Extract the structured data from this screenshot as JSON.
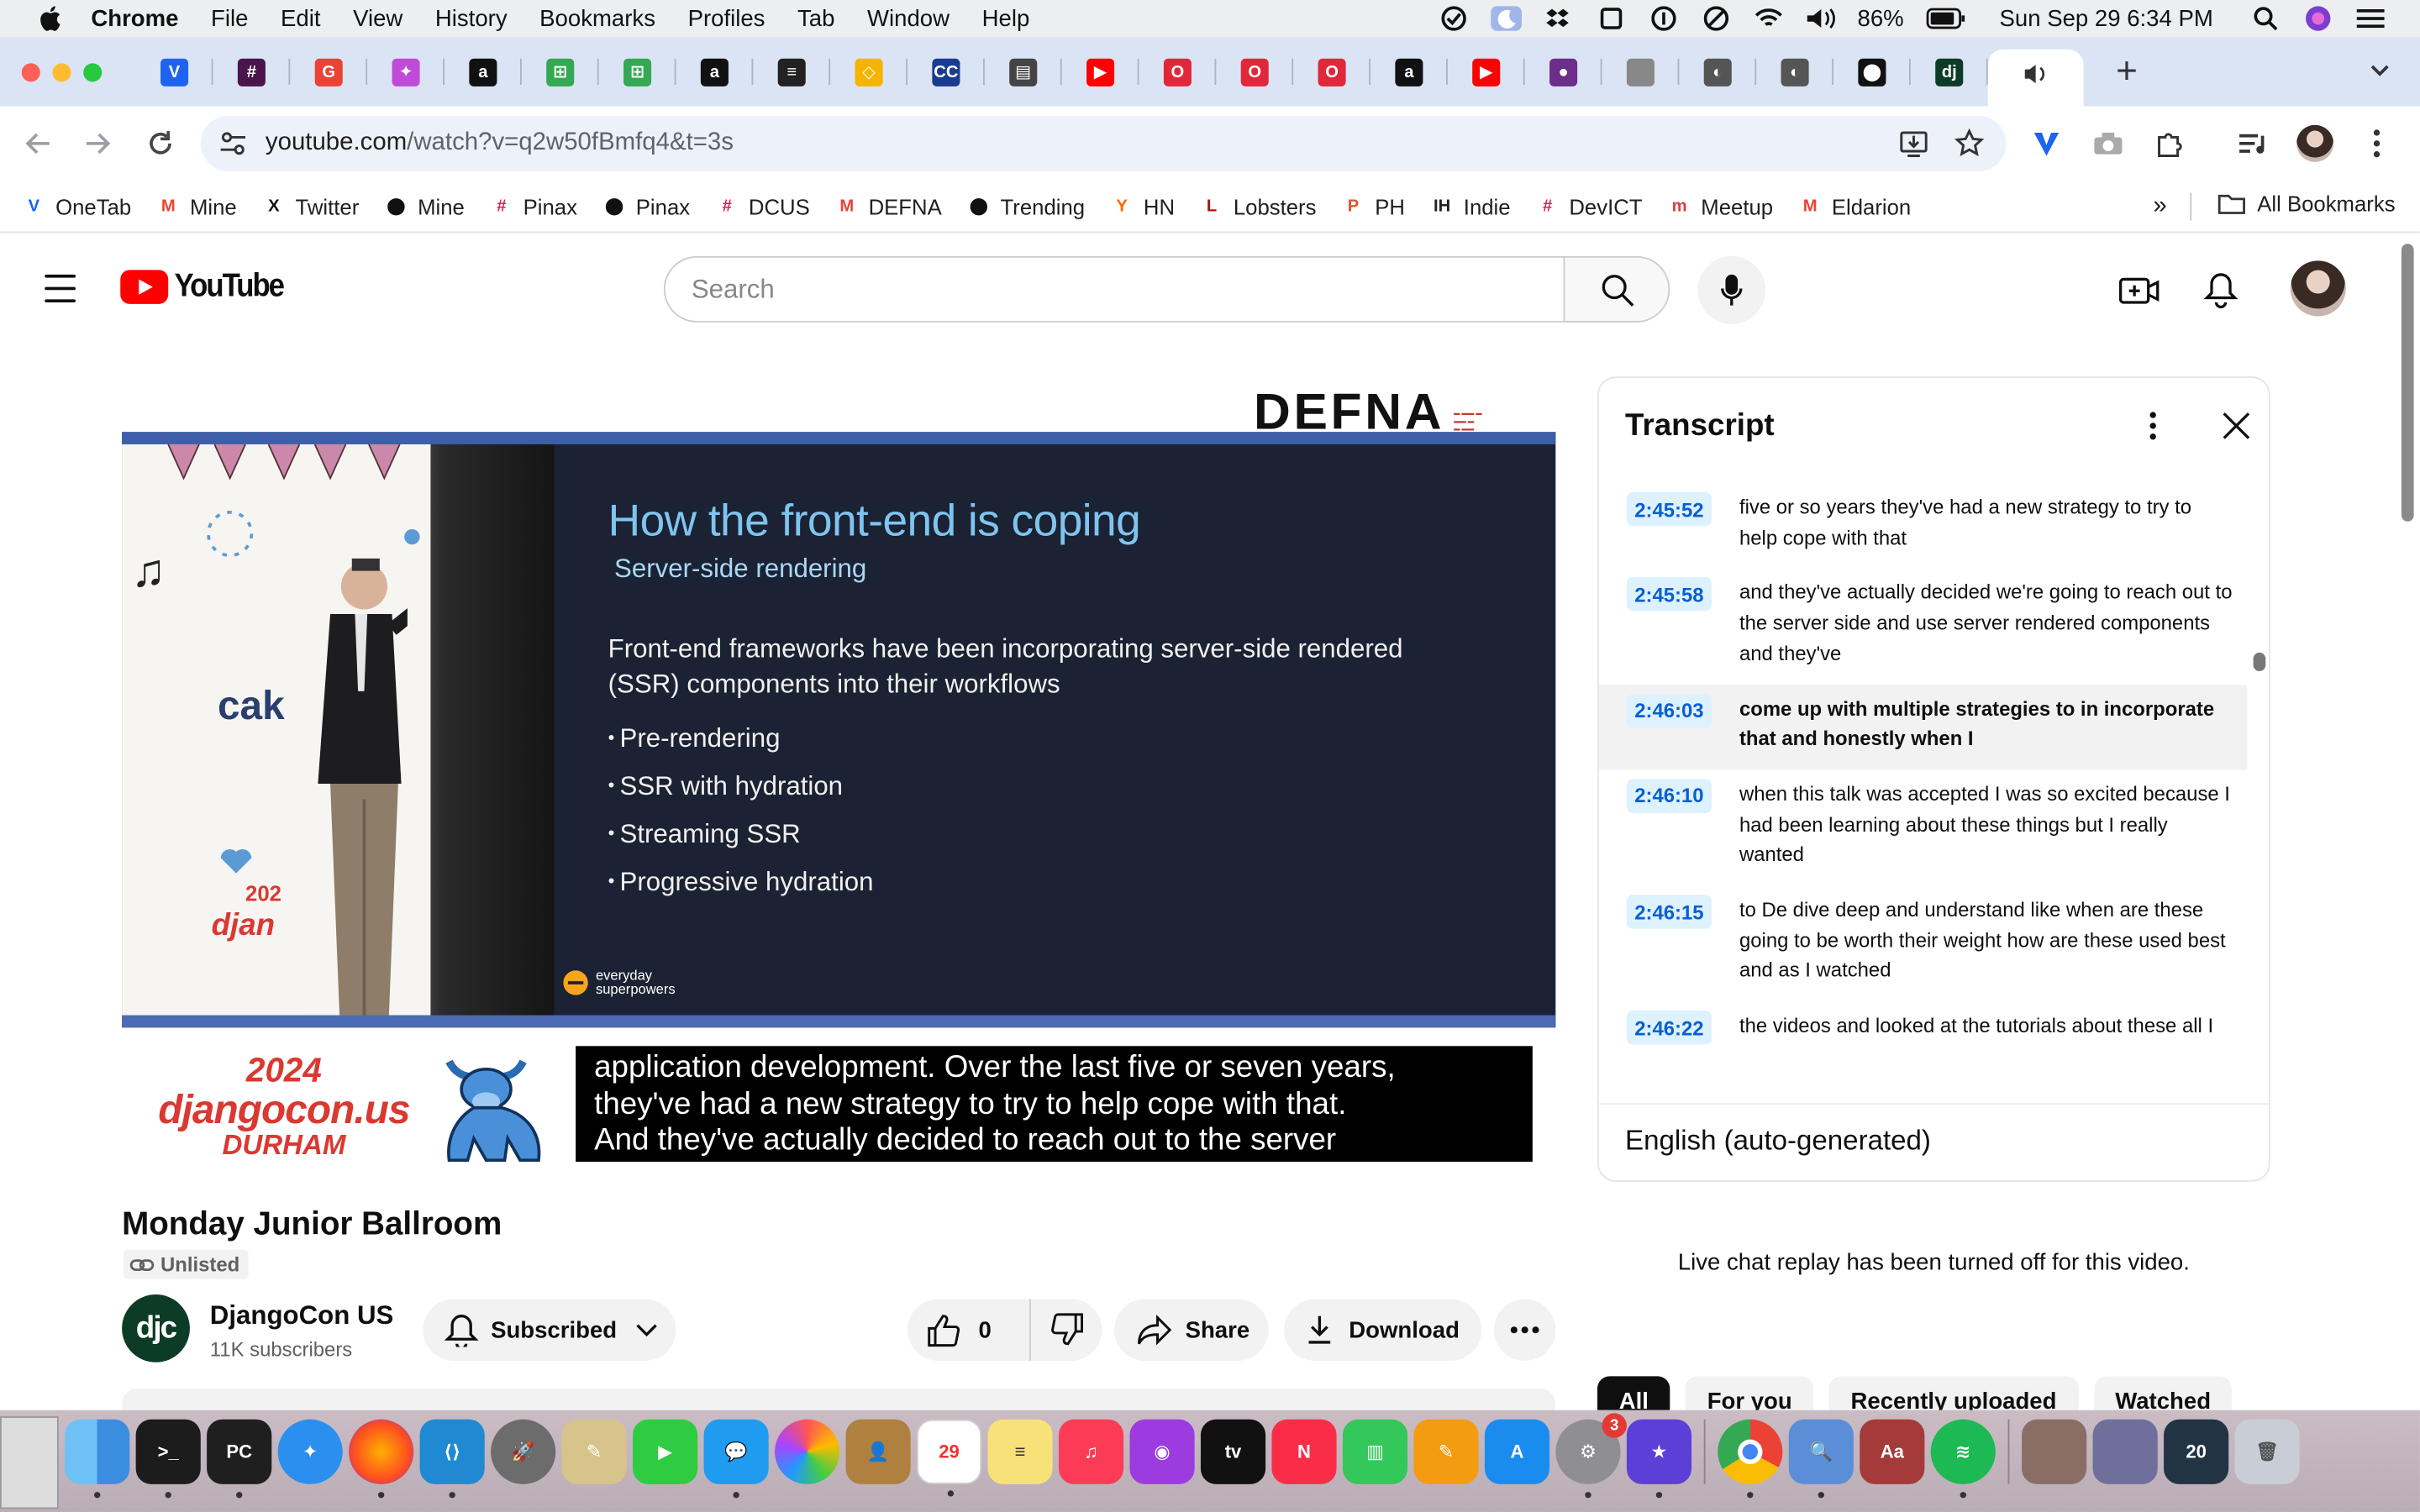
{
  "menubar": {
    "app_name": "Chrome",
    "items": [
      "File",
      "Edit",
      "View",
      "History",
      "Bookmarks",
      "Profiles",
      "Tab",
      "Window",
      "Help"
    ],
    "battery": "86%",
    "datetime": "Sun Sep 29  6:34 PM"
  },
  "tabs": {
    "favicons": [
      {
        "icon": "vivaldi-icon",
        "color": "#1e64f0",
        "glyph": "V"
      },
      {
        "icon": "slack-icon",
        "color": "#4a154b",
        "glyph": "#"
      },
      {
        "icon": "google-icon",
        "color": "#ea4335",
        "glyph": "G"
      },
      {
        "icon": "unicorn-icon",
        "color": "#c04bd8",
        "glyph": "✦"
      },
      {
        "icon": "amazon-icon",
        "color": "#111111",
        "glyph": "a"
      },
      {
        "icon": "sheets-icon",
        "color": "#34a853",
        "glyph": "⊞"
      },
      {
        "icon": "sheets-icon",
        "color": "#34a853",
        "glyph": "⊞"
      },
      {
        "icon": "amazon-icon",
        "color": "#111111",
        "glyph": "a"
      },
      {
        "icon": "layers-icon",
        "color": "#222222",
        "glyph": "≡"
      },
      {
        "icon": "sketch-icon",
        "color": "#f5b400",
        "glyph": "◇"
      },
      {
        "icon": "cc-icon",
        "color": "#1a3c8e",
        "glyph": "CC"
      },
      {
        "icon": "book-icon",
        "color": "#444444",
        "glyph": "▤"
      },
      {
        "icon": "youtube-icon",
        "color": "#ff0000",
        "glyph": "▶"
      },
      {
        "icon": "opera-icon",
        "color": "#e0283a",
        "glyph": "O"
      },
      {
        "icon": "opera-icon",
        "color": "#e0283a",
        "glyph": "O"
      },
      {
        "icon": "opera-icon",
        "color": "#e0283a",
        "glyph": "O"
      },
      {
        "icon": "amazon-icon",
        "color": "#111111",
        "glyph": "a"
      },
      {
        "icon": "youtube-icon",
        "color": "#ff0000",
        "glyph": "▶"
      },
      {
        "icon": "circle-icon",
        "color": "#6b2f8a",
        "glyph": "●"
      },
      {
        "icon": "apple-icon",
        "color": "#888888",
        "glyph": ""
      },
      {
        "icon": "globe-icon",
        "color": "#555555",
        "glyph": "◐"
      },
      {
        "icon": "globe-icon",
        "color": "#555555",
        "glyph": "◐"
      },
      {
        "icon": "github-icon",
        "color": "#111111",
        "glyph": "⬤"
      },
      {
        "icon": "djangocon-icon",
        "color": "#0c3c26",
        "glyph": "dj"
      }
    ],
    "active_tab_icon": "speaker-icon"
  },
  "toolbar": {
    "url_host": "youtube.com",
    "url_path": "/watch?v=q2w50fBmfq4&t=3s"
  },
  "bookmarks": [
    {
      "label": "OneTab",
      "icon": "onetab-icon",
      "color": "#1e64f0",
      "glyph": "V"
    },
    {
      "label": "Mine",
      "icon": "gmail-icon",
      "color": "#ea4335",
      "glyph": "M"
    },
    {
      "label": "Twitter",
      "icon": "x-icon",
      "color": "#111111",
      "glyph": "X"
    },
    {
      "label": "Mine",
      "icon": "github-icon",
      "color": "#111111",
      "glyph": "⬤"
    },
    {
      "label": "Pinax",
      "icon": "slack-icon",
      "color": "#e01e5a",
      "glyph": "#"
    },
    {
      "label": "Pinax",
      "icon": "github-icon",
      "color": "#111111",
      "glyph": "⬤"
    },
    {
      "label": "DCUS",
      "icon": "slack-icon",
      "color": "#e01e5a",
      "glyph": "#"
    },
    {
      "label": "DEFNA",
      "icon": "gmail-icon",
      "color": "#ea4335",
      "glyph": "M"
    },
    {
      "label": "Trending",
      "icon": "github-icon",
      "color": "#111111",
      "glyph": "⬤"
    },
    {
      "label": "HN",
      "icon": "hackernews-icon",
      "color": "#ff6600",
      "glyph": "Y"
    },
    {
      "label": "Lobsters",
      "icon": "lobsters-icon",
      "color": "#ac130d",
      "glyph": "L"
    },
    {
      "label": "PH",
      "icon": "producthunt-icon",
      "color": "#da552f",
      "glyph": "P"
    },
    {
      "label": "Indie",
      "icon": "indie-icon",
      "color": "#222222",
      "glyph": "IH"
    },
    {
      "label": "DevICT",
      "icon": "slack-icon",
      "color": "#e01e5a",
      "glyph": "#"
    },
    {
      "label": "Meetup",
      "icon": "meetup-icon",
      "color": "#e0393e",
      "glyph": "m"
    },
    {
      "label": "Eldarion",
      "icon": "gmail-icon",
      "color": "#ea4335",
      "glyph": "M"
    }
  ],
  "bookmarks_all": "All Bookmarks",
  "youtube": {
    "logo_text": "YouTube",
    "search_placeholder": "Search"
  },
  "video": {
    "defna_logo": "DEFNA",
    "slide_title": "How the front-end is coping",
    "slide_subtitle": "Server-side rendering",
    "slide_body": "Front-end frameworks have been incorporating server-side rendered (SSR) components into their workflows",
    "slide_bullets": [
      "Pre-rendering",
      "SSR with hydration",
      "Streaming SSR",
      "Progressive hydration"
    ],
    "slide_brand": "everyday superpowers",
    "conf_year": "2024",
    "conf_name": "djangocon.us",
    "conf_city": "DURHAM",
    "captions": [
      "application development. Over the last five or seven years,",
      "they've had a new strategy to try to help cope with that.",
      "And they've actually decided to reach out to the server"
    ]
  },
  "below_video": {
    "title": "Monday Junior Ballroom",
    "unlisted": "Unlisted",
    "channel_name": "DjangoCon US",
    "channel_subs": "11K subscribers",
    "channel_avatar": "djc",
    "subscribe_label": "Subscribed",
    "like_count": "0",
    "share_label": "Share",
    "download_label": "Download"
  },
  "transcript": {
    "title": "Transcript",
    "segments": [
      {
        "time": "2:45:52",
        "text": "five or so years they've had a new strategy to try to help cope with that"
      },
      {
        "time": "2:45:58",
        "text": "and they've actually decided we're going to reach out to the server side and use server rendered components and they've"
      },
      {
        "time": "2:46:03",
        "text": "come up with multiple strategies to in incorporate that and honestly when I",
        "active": true
      },
      {
        "time": "2:46:10",
        "text": "when this talk was accepted I was so excited because I had been learning about these things but I really wanted"
      },
      {
        "time": "2:46:15",
        "text": "to De dive deep and understand like when are these going to be worth their weight how are these used best and as I watched"
      },
      {
        "time": "2:46:22",
        "text": "the videos and looked at the tutorials about these all I"
      }
    ],
    "language": "English (auto-generated)"
  },
  "live_chat": "Live chat replay has been turned off for this video.",
  "chips": [
    "All",
    "For you",
    "Recently uploaded",
    "Watched"
  ]
}
